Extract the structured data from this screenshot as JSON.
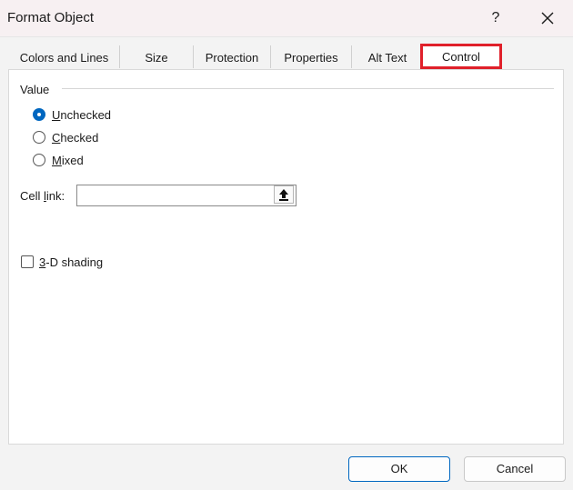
{
  "window": {
    "title": "Format Object",
    "help_label": "?"
  },
  "tabs": [
    {
      "label": "Colors and Lines"
    },
    {
      "label": "Size"
    },
    {
      "label": "Protection"
    },
    {
      "label": "Properties"
    },
    {
      "label": "Alt Text"
    },
    {
      "label": "Control"
    }
  ],
  "active_tab": "Control",
  "value_group": {
    "label": "Value",
    "options": [
      {
        "prefix": "",
        "accel": "U",
        "rest": "nchecked",
        "checked": true
      },
      {
        "prefix": "",
        "accel": "C",
        "rest": "hecked",
        "checked": false
      },
      {
        "prefix": "",
        "accel": "M",
        "rest": "ixed",
        "checked": false
      }
    ]
  },
  "cell_link": {
    "label_prefix": "Cell ",
    "label_accel": "l",
    "label_rest": "ink:",
    "value": ""
  },
  "shading": {
    "accel": "3",
    "rest": "-D shading",
    "checked": false
  },
  "buttons": {
    "ok": "OK",
    "cancel": "Cancel"
  },
  "colors": {
    "accent": "#0067c0",
    "highlight": "#e0202a"
  }
}
